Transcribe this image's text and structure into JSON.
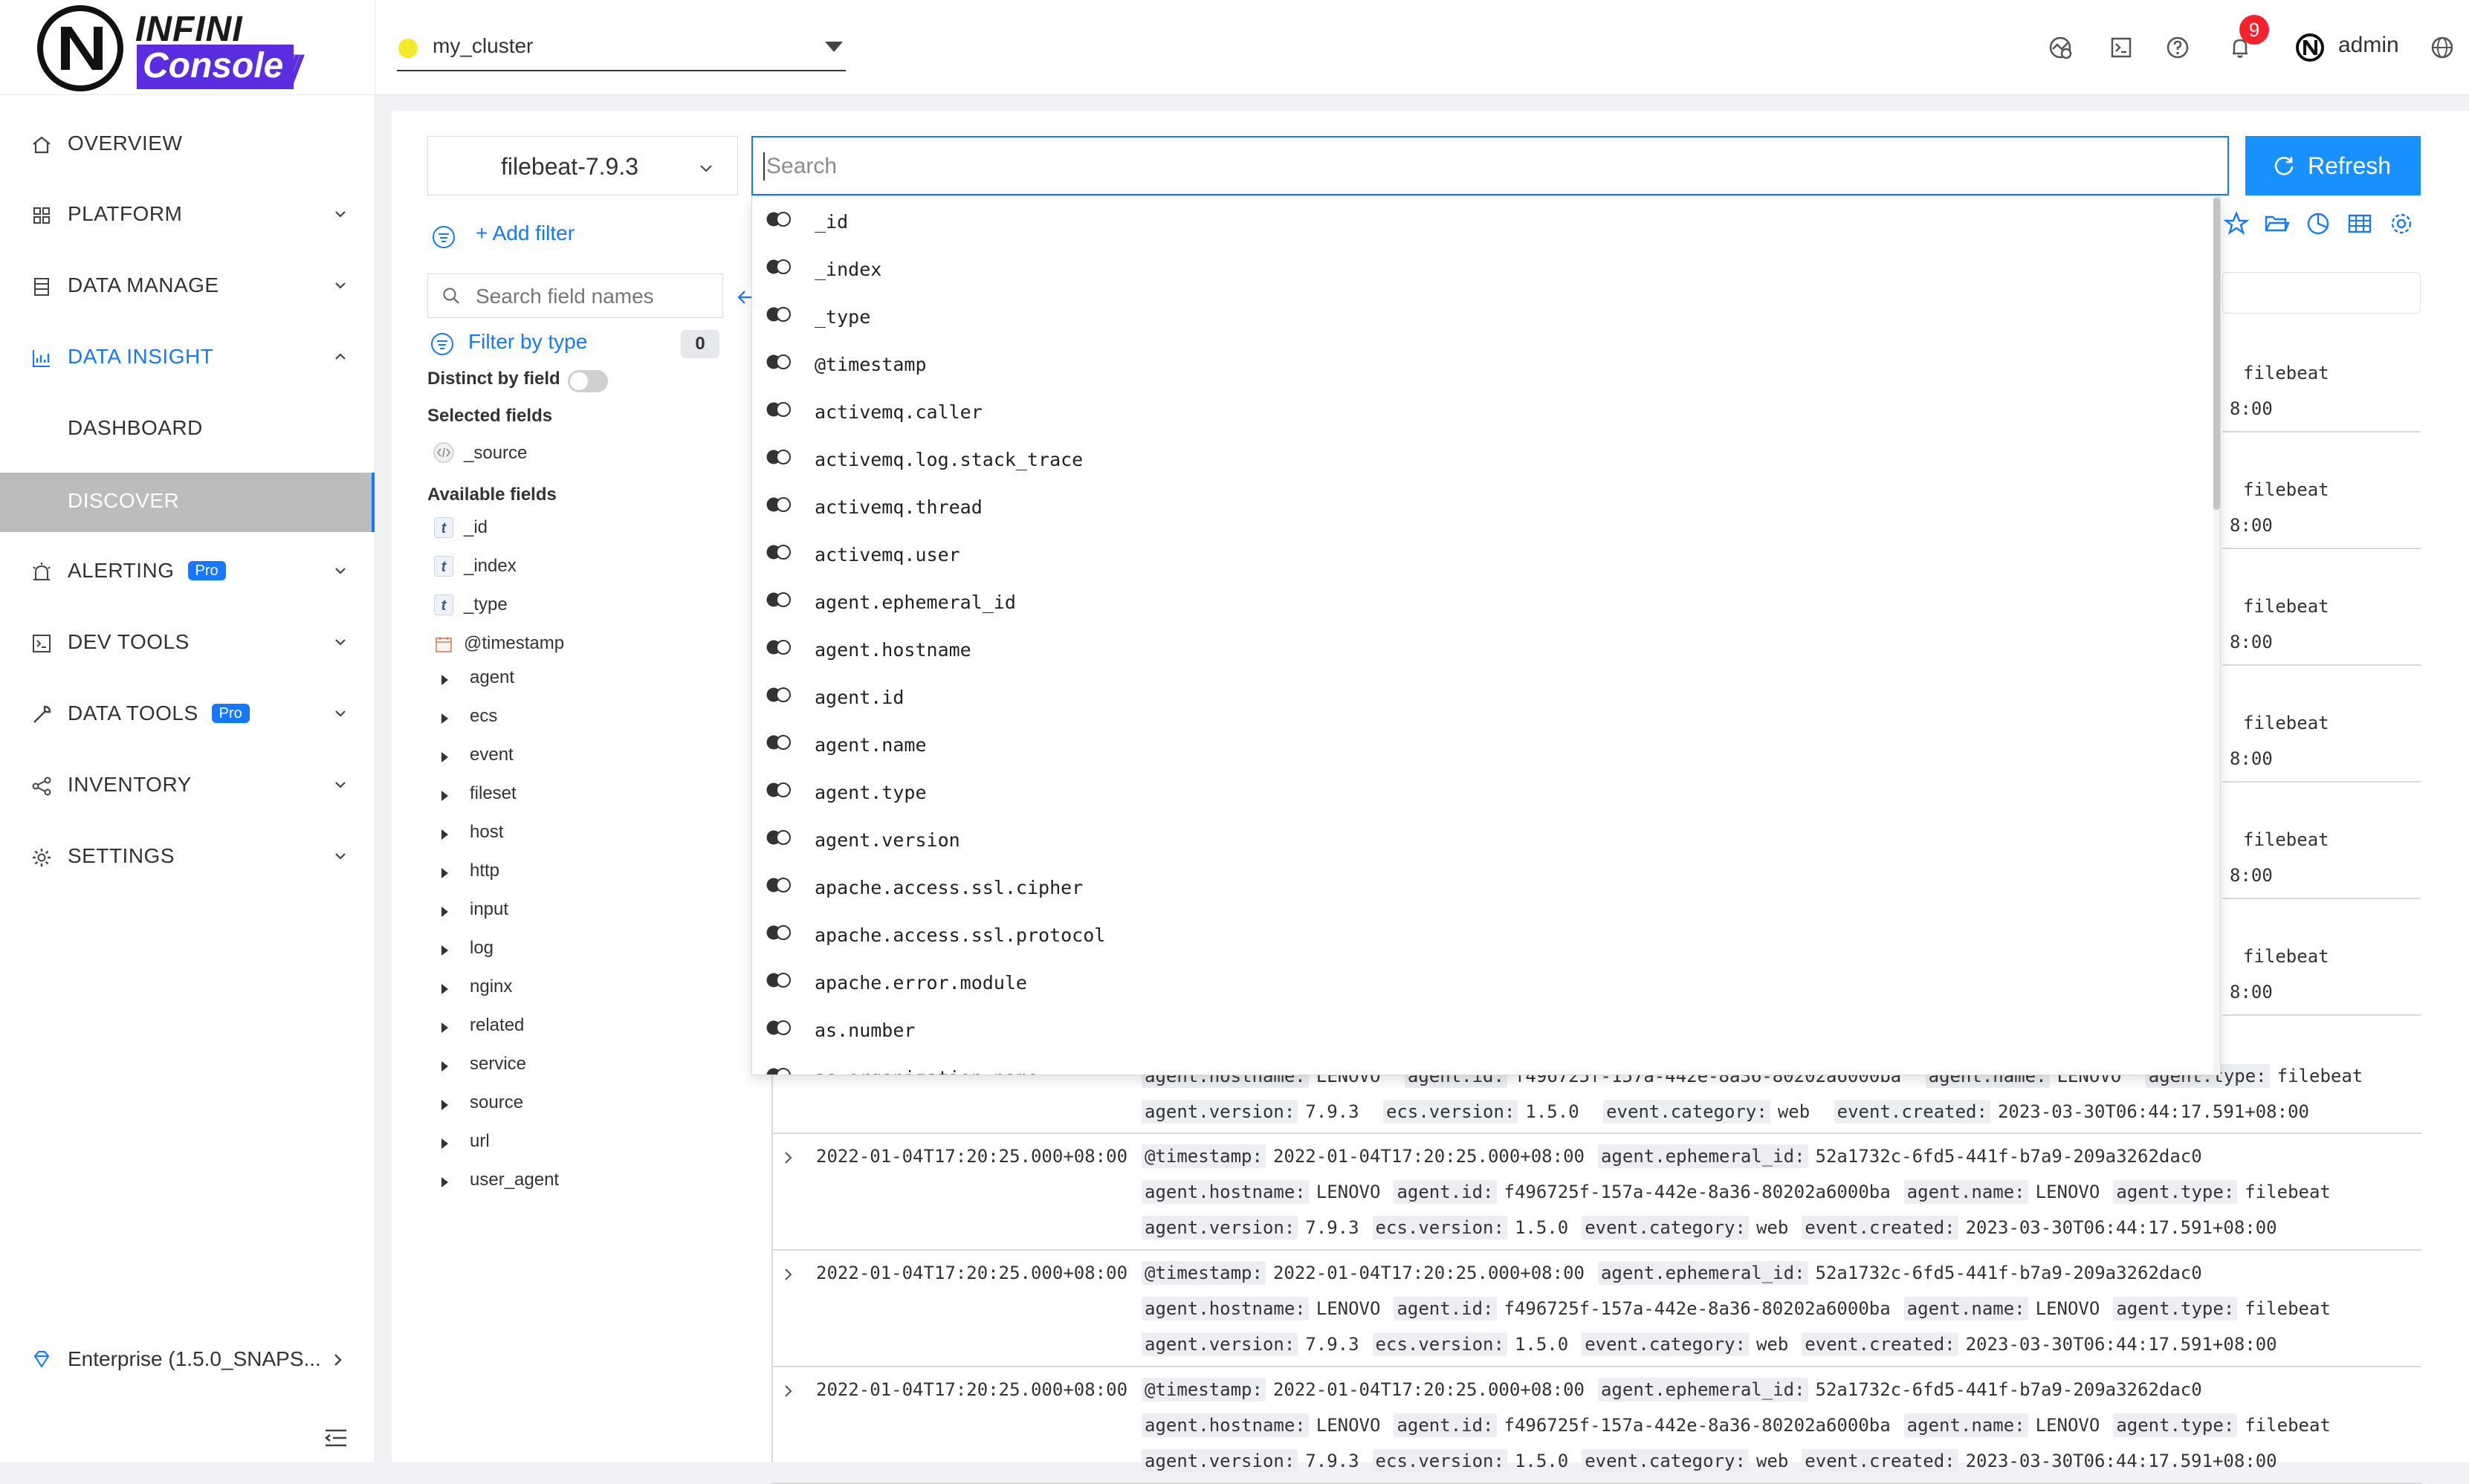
{
  "brand": {
    "top": "INFINI",
    "bottom": "Console",
    "slashes": "///"
  },
  "header": {
    "cluster": "my_cluster",
    "notifications_count": "9",
    "user": "admin",
    "icons": [
      "chart-globe-icon",
      "terminal-icon",
      "help-icon",
      "bell-icon",
      "user-avatar-icon",
      "language-icon"
    ]
  },
  "sidebar": {
    "items": [
      {
        "label": "OVERVIEW",
        "icon": "home-icon",
        "pro": "",
        "chevron": "none"
      },
      {
        "label": "PLATFORM",
        "icon": "cluster-icon",
        "pro": "",
        "chevron": "down"
      },
      {
        "label": "DATA MANAGE",
        "icon": "database-icon",
        "pro": "",
        "chevron": "down"
      },
      {
        "label": "DATA INSIGHT",
        "icon": "chart-icon",
        "pro": "",
        "chevron": "up"
      },
      {
        "label": "DASHBOARD",
        "icon": "",
        "pro": "",
        "chevron": "none"
      },
      {
        "label": "DISCOVER",
        "icon": "",
        "pro": "",
        "chevron": "none"
      },
      {
        "label": "ALERTING",
        "icon": "alarm-icon",
        "pro": "Pro",
        "chevron": "down"
      },
      {
        "label": "DEV TOOLS",
        "icon": "code-icon",
        "pro": "",
        "chevron": "down"
      },
      {
        "label": "DATA TOOLS",
        "icon": "wrench-icon",
        "pro": "Pro",
        "chevron": "down"
      },
      {
        "label": "INVENTORY",
        "icon": "share-icon",
        "pro": "",
        "chevron": "down"
      },
      {
        "label": "SETTINGS",
        "icon": "gear-icon",
        "pro": "",
        "chevron": "down"
      }
    ],
    "active": "DISCOVER",
    "enterprise": "Enterprise (1.5.0_SNAPS..."
  },
  "discover": {
    "index": "filebeat-7.9.3",
    "search_placeholder": "Search",
    "refresh_label": "Refresh",
    "add_filter": "+ Add filter",
    "field_search_placeholder": "Search field names",
    "filter_by_type": "Filter by type",
    "filter_count": "0",
    "distinct_label": "Distinct by field",
    "distinct_on": false,
    "selected_title": "Selected fields",
    "selected_fields": [
      "_source"
    ],
    "available_title": "Available fields",
    "available_fields": [
      {
        "type": "t",
        "name": "_id"
      },
      {
        "type": "t",
        "name": "_index"
      },
      {
        "type": "t",
        "name": "_type"
      },
      {
        "type": "date",
        "name": "@timestamp"
      }
    ],
    "field_groups": [
      "agent",
      "ecs",
      "event",
      "fileset",
      "host",
      "http",
      "input",
      "log",
      "nginx",
      "related",
      "service",
      "source",
      "url",
      "user_agent"
    ],
    "suggestions": [
      "_id",
      "_index",
      "_type",
      "@timestamp",
      "activemq.caller",
      "activemq.log.stack_trace",
      "activemq.thread",
      "activemq.user",
      "agent.ephemeral_id",
      "agent.hostname",
      "agent.id",
      "agent.name",
      "agent.type",
      "agent.version",
      "apache.access.ssl.cipher",
      "apache.access.ssl.protocol",
      "apache.error.module",
      "as.number",
      "as.organization.name"
    ],
    "visible_row_fragments": [
      {
        "line1": "filebeat",
        "line2": "8:00"
      },
      {
        "line1": "filebeat",
        "line2": "8:00"
      },
      {
        "line1": "filebeat",
        "line2": "8:00"
      },
      {
        "line1": "filebeat",
        "line2": "8:00"
      },
      {
        "line1": "filebeat",
        "line2": "8:00"
      },
      {
        "line1": "filebeat",
        "line2": "8:00"
      }
    ],
    "partial_row": {
      "line1": [
        {
          "k": "agent.hostname:",
          "v": "LENOVO"
        },
        {
          "k": "agent.id:",
          "v": "f496725f-157a-442e-8a36-80202a6000ba"
        },
        {
          "k": "agent.name:",
          "v": "LENOVO"
        },
        {
          "k": "agent.type:",
          "v": "filebeat"
        }
      ],
      "line2": [
        {
          "k": "agent.version:",
          "v": "7.9.3"
        },
        {
          "k": "ecs.version:",
          "v": "1.5.0"
        },
        {
          "k": "event.category:",
          "v": "web"
        },
        {
          "k": "event.created:",
          "v": "2023-03-30T06:44:17.591+08:00"
        }
      ]
    },
    "documents": [
      {
        "time": "2022-01-04T17:20:25.000+08:00",
        "line1": [
          {
            "k": "@timestamp:",
            "v": "2022-01-04T17:20:25.000+08:00"
          },
          {
            "k": "agent.ephemeral_id:",
            "v": "52a1732c-6fd5-441f-b7a9-209a3262dac0"
          }
        ],
        "line2": [
          {
            "k": "agent.hostname:",
            "v": "LENOVO"
          },
          {
            "k": "agent.id:",
            "v": "f496725f-157a-442e-8a36-80202a6000ba"
          },
          {
            "k": "agent.name:",
            "v": "LENOVO"
          },
          {
            "k": "agent.type:",
            "v": "filebeat"
          }
        ],
        "line3": [
          {
            "k": "agent.version:",
            "v": "7.9.3"
          },
          {
            "k": "ecs.version:",
            "v": "1.5.0"
          },
          {
            "k": "event.category:",
            "v": "web"
          },
          {
            "k": "event.created:",
            "v": "2023-03-30T06:44:17.591+08:00"
          }
        ]
      },
      {
        "time": "2022-01-04T17:20:25.000+08:00",
        "line1": [
          {
            "k": "@timestamp:",
            "v": "2022-01-04T17:20:25.000+08:00"
          },
          {
            "k": "agent.ephemeral_id:",
            "v": "52a1732c-6fd5-441f-b7a9-209a3262dac0"
          }
        ],
        "line2": [
          {
            "k": "agent.hostname:",
            "v": "LENOVO"
          },
          {
            "k": "agent.id:",
            "v": "f496725f-157a-442e-8a36-80202a6000ba"
          },
          {
            "k": "agent.name:",
            "v": "LENOVO"
          },
          {
            "k": "agent.type:",
            "v": "filebeat"
          }
        ],
        "line3": [
          {
            "k": "agent.version:",
            "v": "7.9.3"
          },
          {
            "k": "ecs.version:",
            "v": "1.5.0"
          },
          {
            "k": "event.category:",
            "v": "web"
          },
          {
            "k": "event.created:",
            "v": "2023-03-30T06:44:17.591+08:00"
          }
        ]
      },
      {
        "time": "2022-01-04T17:20:25.000+08:00",
        "line1": [
          {
            "k": "@timestamp:",
            "v": "2022-01-04T17:20:25.000+08:00"
          },
          {
            "k": "agent.ephemeral_id:",
            "v": "52a1732c-6fd5-441f-b7a9-209a3262dac0"
          }
        ],
        "line2": [
          {
            "k": "agent.hostname:",
            "v": "LENOVO"
          },
          {
            "k": "agent.id:",
            "v": "f496725f-157a-442e-8a36-80202a6000ba"
          },
          {
            "k": "agent.name:",
            "v": "LENOVO"
          },
          {
            "k": "agent.type:",
            "v": "filebeat"
          }
        ],
        "line3": [
          {
            "k": "agent.version:",
            "v": "7.9.3"
          },
          {
            "k": "ecs.version:",
            "v": "1.5.0"
          },
          {
            "k": "event.category:",
            "v": "web"
          },
          {
            "k": "event.created:",
            "v": "2023-03-30T06:44:17.591+08:00"
          }
        ]
      }
    ],
    "toolbar_icons": [
      "star-icon",
      "folder-open-icon",
      "pie-chart-icon",
      "table-icon",
      "settings-icon"
    ]
  },
  "colors": {
    "accent": "#1677ff",
    "brand": "#5a2de0",
    "active_nav_bg": "#bcbcbc",
    "badge": "#f5222d"
  }
}
